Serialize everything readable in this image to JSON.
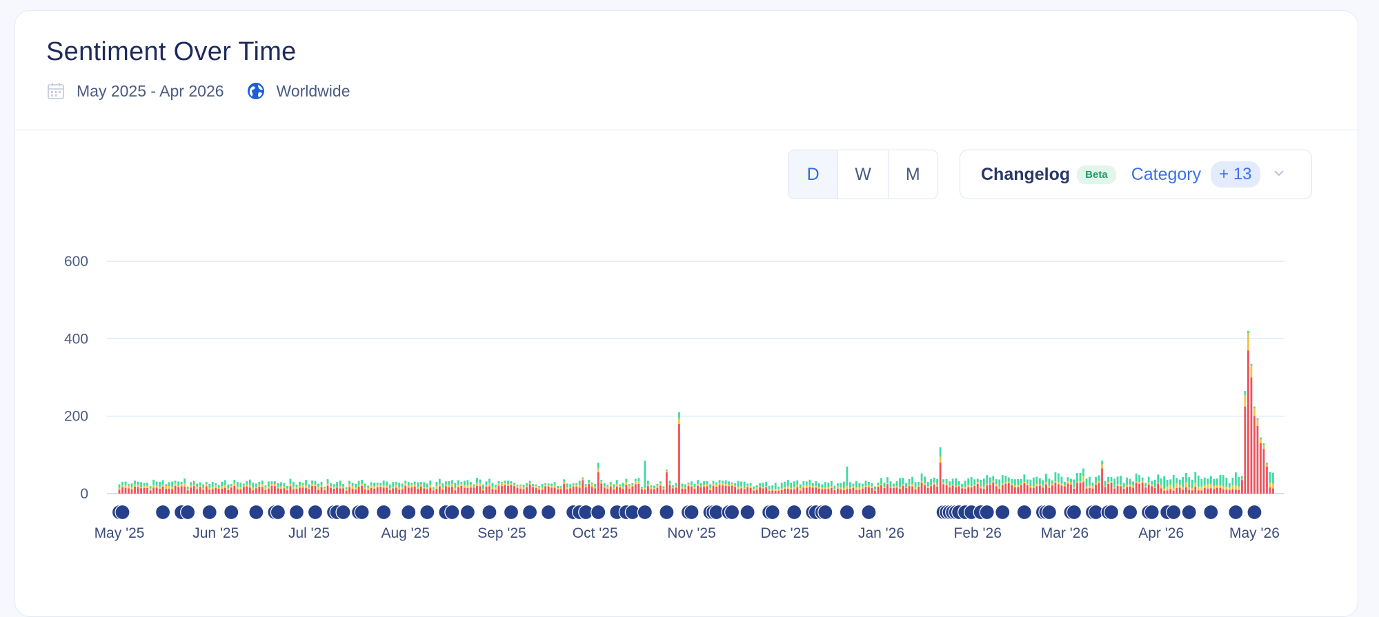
{
  "header": {
    "title": "Sentiment Over Time",
    "date_range": "May 2025 - Apr 2026",
    "region": "Worldwide",
    "calendar_icon": "calendar-icon",
    "globe_icon": "globe-icon"
  },
  "toggle": {
    "options": [
      "D",
      "W",
      "M"
    ],
    "active": "D"
  },
  "filter": {
    "changelog_label": "Changelog",
    "beta_label": "Beta",
    "category_label": "Category",
    "count_label": "+ 13",
    "chevron_icon": "chevron-down-icon"
  },
  "colors": {
    "negative": "#f0505a",
    "neutral": "#f3c443",
    "positive": "#3ddba4",
    "marker": "#27408b",
    "grid": "#d6e2f3"
  },
  "chart_data": {
    "type": "bar",
    "stacked": true,
    "start_date": "2025-05-01",
    "end_date": "2026-05-08",
    "ylim": [
      0,
      600
    ],
    "yticks": [
      0,
      200,
      400,
      600
    ],
    "xticks": [
      "May '25",
      "Jun '25",
      "Jul '25",
      "Aug '25",
      "Sep '25",
      "Oct '25",
      "Nov '25",
      "Dec '25",
      "Jan '26",
      "Feb '26",
      "Mar '26",
      "Apr '26",
      "May '26"
    ],
    "grid": true,
    "baseline_days": [
      {
        "from": "2025-05-01",
        "to": "2025-08-31",
        "negative": 14,
        "neutral": 5,
        "positive": 8
      },
      {
        "from": "2025-09-01",
        "to": "2025-10-15",
        "negative": 18,
        "neutral": 5,
        "positive": 6
      },
      {
        "from": "2025-10-16",
        "to": "2025-11-15",
        "negative": 16,
        "neutral": 4,
        "positive": 6
      },
      {
        "from": "2025-11-16",
        "to": "2025-12-31",
        "negative": 12,
        "neutral": 4,
        "positive": 10
      },
      {
        "from": "2026-01-01",
        "to": "2026-03-31",
        "negative": 20,
        "neutral": 4,
        "positive": 14
      },
      {
        "from": "2026-04-01",
        "to": "2026-04-28",
        "negative": 12,
        "neutral": 8,
        "positive": 20
      }
    ],
    "notable_days": [
      {
        "date": "2025-09-27",
        "negative": 35,
        "neutral": 4,
        "positive": 3
      },
      {
        "date": "2025-10-02",
        "negative": 55,
        "neutral": 10,
        "positive": 15
      },
      {
        "date": "2025-10-17",
        "negative": 10,
        "neutral": 5,
        "positive": 70
      },
      {
        "date": "2025-10-24",
        "negative": 55,
        "neutral": 4,
        "positive": 3
      },
      {
        "date": "2025-10-28",
        "negative": 180,
        "neutral": 15,
        "positive": 15
      },
      {
        "date": "2025-12-21",
        "negative": 12,
        "neutral": 8,
        "positive": 50
      },
      {
        "date": "2026-01-20",
        "negative": 80,
        "neutral": 15,
        "positive": 25
      },
      {
        "date": "2026-03-07",
        "negative": 30,
        "neutral": 15,
        "positive": 20
      },
      {
        "date": "2026-03-13",
        "negative": 65,
        "neutral": 10,
        "positive": 10
      },
      {
        "date": "2026-04-27",
        "negative": 35,
        "neutral": 5,
        "positive": 5
      },
      {
        "date": "2026-04-28",
        "negative": 225,
        "neutral": 30,
        "positive": 10
      },
      {
        "date": "2026-04-29",
        "negative": 370,
        "neutral": 45,
        "positive": 5
      },
      {
        "date": "2026-04-30",
        "negative": 300,
        "neutral": 30,
        "positive": 5
      },
      {
        "date": "2026-05-01",
        "negative": 200,
        "neutral": 20,
        "positive": 5
      },
      {
        "date": "2026-05-02",
        "negative": 175,
        "neutral": 15,
        "positive": 5
      },
      {
        "date": "2026-05-03",
        "negative": 130,
        "neutral": 10,
        "positive": 5
      },
      {
        "date": "2026-05-04",
        "negative": 115,
        "neutral": 10,
        "positive": 5
      },
      {
        "date": "2026-05-05",
        "negative": 70,
        "neutral": 5,
        "positive": 5
      }
    ],
    "changelog_markers": [
      "2025-05-01",
      "2025-05-02",
      "2025-05-15",
      "2025-05-21",
      "2025-05-23",
      "2025-05-30",
      "2025-06-06",
      "2025-06-14",
      "2025-06-20",
      "2025-06-21",
      "2025-06-27",
      "2025-07-03",
      "2025-07-09",
      "2025-07-10",
      "2025-07-12",
      "2025-07-17",
      "2025-07-18",
      "2025-07-25",
      "2025-08-02",
      "2025-08-08",
      "2025-08-14",
      "2025-08-16",
      "2025-08-21",
      "2025-08-28",
      "2025-09-04",
      "2025-09-10",
      "2025-09-16",
      "2025-09-24",
      "2025-09-26",
      "2025-09-28",
      "2025-10-02",
      "2025-10-08",
      "2025-10-11",
      "2025-10-13",
      "2025-10-17",
      "2025-10-24",
      "2025-10-31",
      "2025-11-01",
      "2025-11-07",
      "2025-11-08",
      "2025-11-09",
      "2025-11-13",
      "2025-11-14",
      "2025-11-19",
      "2025-11-26",
      "2025-11-27",
      "2025-12-04",
      "2025-12-10",
      "2025-12-11",
      "2025-12-13",
      "2025-12-14",
      "2025-12-21",
      "2025-12-28",
      "2026-01-21",
      "2026-01-22",
      "2026-01-23",
      "2026-01-24",
      "2026-01-25",
      "2026-01-26",
      "2026-01-28",
      "2026-01-30",
      "2026-02-02",
      "2026-02-04",
      "2026-02-09",
      "2026-02-16",
      "2026-02-22",
      "2026-02-23",
      "2026-02-24",
      "2026-03-03",
      "2026-03-04",
      "2026-03-10",
      "2026-03-11",
      "2026-03-15",
      "2026-03-16",
      "2026-03-22",
      "2026-03-28",
      "2026-03-29",
      "2026-04-03",
      "2026-04-05",
      "2026-04-10",
      "2026-04-17",
      "2026-04-25",
      "2026-05-01"
    ]
  }
}
